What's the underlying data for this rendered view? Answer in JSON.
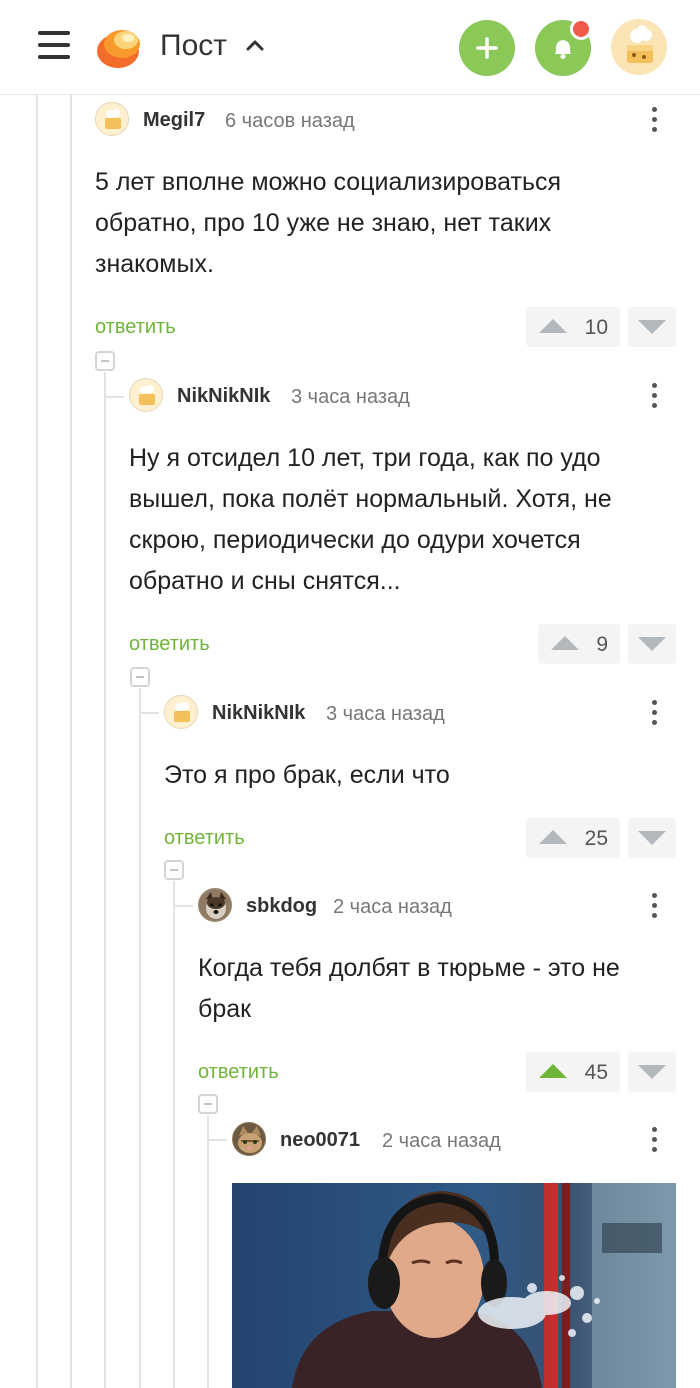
{
  "header": {
    "title": "Пост",
    "icons": {
      "menu": "menu-icon",
      "chevron": "chevron-up-icon",
      "add": "plus-icon",
      "notifications": "bell-icon"
    },
    "brand_color": "#8ac858",
    "notification_dot_color": "#f25a4a"
  },
  "comments": [
    {
      "author": "Megil7",
      "time": "6 часов назад",
      "text": "5 лет вполне можно социализироваться обратно, про 10 уже не знаю, нет таких знакомых.",
      "reply_label": "ответить",
      "rating": "10",
      "upvoted": false
    },
    {
      "author": "NikNikNIk",
      "time": "3 часа назад",
      "text": "Ну я отсидел 10 лет, три года, как по удо вышел, пока полёт нормальный. Хотя, не скрою, периодически до одури хочется обратно и сны снятся...",
      "reply_label": "ответить",
      "rating": "9",
      "upvoted": false
    },
    {
      "author": "NikNikNIk",
      "time": "3 часа назад",
      "text": "Это я про брак, если что",
      "reply_label": "ответить",
      "rating": "25",
      "upvoted": false
    },
    {
      "author": "sbkdog",
      "time": "2 часа назад",
      "text": "Когда тебя долбят в тюрьме - это не брак",
      "reply_label": "ответить",
      "rating": "45",
      "upvoted": true
    },
    {
      "author": "neo0071",
      "time": "2 часа назад",
      "image": "man-in-headphones-spitting-water-photo"
    }
  ],
  "colors": {
    "accent_green": "#6fb53a",
    "vote_gray": "#b3b8bd"
  }
}
